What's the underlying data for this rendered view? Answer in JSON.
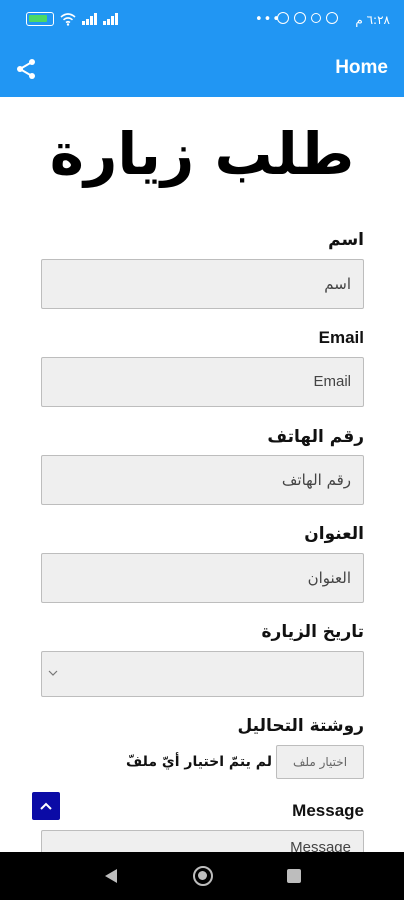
{
  "status_bar": {
    "time": "٦:٢٨ م",
    "battery_icon": "battery-charging-icon",
    "wifi_icon": "wifi-icon",
    "signal_icon": "signal-bars-icon"
  },
  "app_bar": {
    "home_label": "Home",
    "share_icon": "share-icon",
    "background": "#2196F3"
  },
  "page": {
    "title": "طلب زيارة"
  },
  "form": {
    "name": {
      "label": "اسم",
      "placeholder": "اسم"
    },
    "email": {
      "label": "Email",
      "placeholder": "Email"
    },
    "phone": {
      "label": "رقم الهاتف",
      "placeholder": "رقم الهاتف"
    },
    "address": {
      "label": "العنوان",
      "placeholder": "العنوان"
    },
    "visit_date": {
      "label": "تاريخ الزيارة",
      "value": ""
    },
    "prescription": {
      "label": "روشتة التحاليل",
      "button_label": "اختيار ملف",
      "status": "لم يتمّ اختيار أيّ ملفّ"
    },
    "message": {
      "label": "Message",
      "placeholder": "Message"
    }
  },
  "colors": {
    "accent": "#2196F3",
    "scroll_top_button": "#0b0ba6",
    "input_bg": "#efefef"
  }
}
